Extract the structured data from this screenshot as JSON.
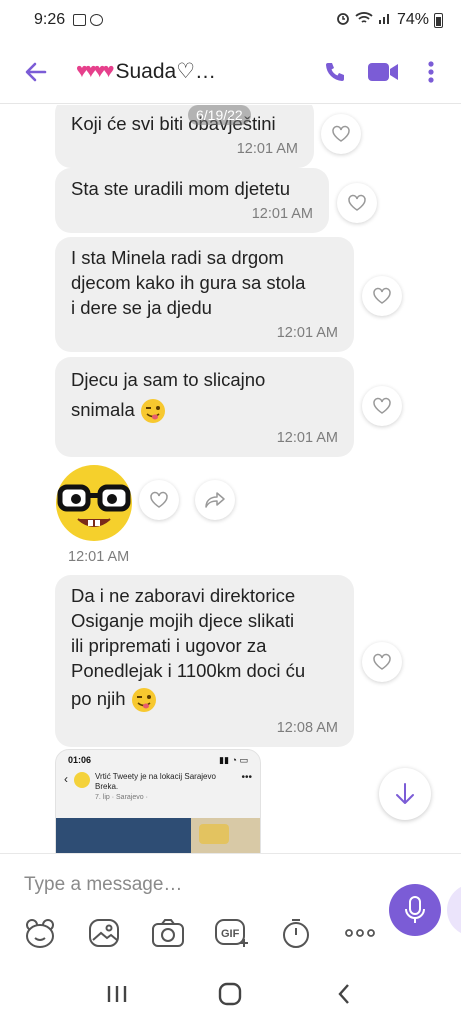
{
  "status_bar": {
    "time": "9:26",
    "battery": "74%"
  },
  "header": {
    "title": "Suada♡…",
    "hearts": "♥♥♥♥",
    "back_icon": "arrow-left-icon",
    "call_icon": "phone-icon",
    "video_icon": "video-camera-icon",
    "more_icon": "more-vertical-icon"
  },
  "date_chip": "6/19/22",
  "messages": [
    {
      "text": "Koji će svi biti obavještini",
      "time": "12:01 AM"
    },
    {
      "text": "Sta ste uradili mom djetetu",
      "time": "12:01 AM"
    },
    {
      "lines": [
        "I sta Minela radi sa drgom",
        "djecom kako ih gura sa stola",
        "i dere se ja djedu"
      ],
      "time": "12:01 AM"
    },
    {
      "lines": [
        "Djecu ja sam to slicajno",
        "snimala"
      ],
      "time": "12:01 AM",
      "emoji": "winking-face-tongue"
    },
    {
      "sticker": "nerd-face-sticker",
      "time": "12:01 AM"
    },
    {
      "lines": [
        "Da i ne zaboravi direktorice",
        "Osiganje mojih djece slikati",
        "ili pripremati i ugovor za",
        "Ponedlejak i 1100km doci ću",
        "po njih"
      ],
      "time": "12:08 AM",
      "emoji": "winking-face-tongue"
    }
  ],
  "shared_preview": {
    "time": "01:06",
    "post_line1": "Vrtić Tweety je na lokacij Sarajevo",
    "post_line2": "Breka.",
    "post_sub": "7. lip · Sarajevo ·"
  },
  "composer": {
    "placeholder": "Type a message…",
    "tools": [
      "sticker-icon",
      "gallery-icon",
      "camera-icon",
      "gif-icon",
      "timer-icon",
      "more-horizontal-icon"
    ],
    "gif_label": "GIF",
    "mic_icon": "microphone-icon"
  },
  "accent_color": "#7b5cd6"
}
